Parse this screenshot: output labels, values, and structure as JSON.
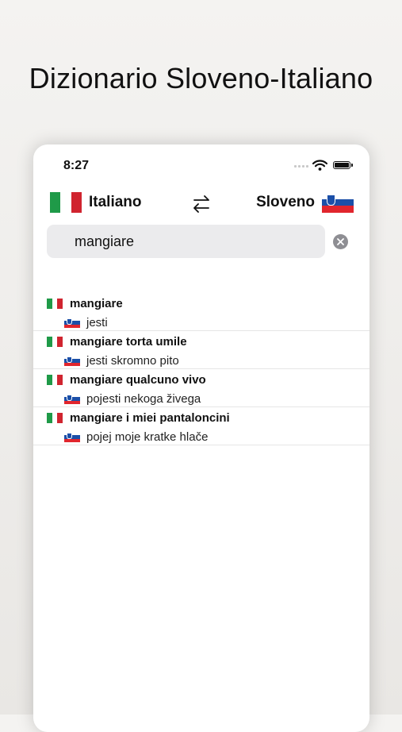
{
  "headline": "Dizionario Sloveno-Italiano",
  "status_bar": {
    "time": "8:27"
  },
  "colors": {
    "italy": [
      "#1f9a48",
      "#ffffff",
      "#d0242f"
    ],
    "slovenia": [
      "#ffffff",
      "#1b4fa8",
      "#e1252d"
    ]
  },
  "language_bar": {
    "source_label": "Italiano",
    "target_label": "Sloveno",
    "source_flag_icon": "italy-flag-icon",
    "target_flag_icon": "slovenia-flag-icon",
    "swap_icon": "swap-arrows-icon"
  },
  "search": {
    "value": "mangiare",
    "clear_icon": "clear-x-icon"
  },
  "results": [
    {
      "source": "mangiare",
      "translation": "jesti"
    },
    {
      "source": "mangiare torta umile",
      "translation": "jesti skromno pito"
    },
    {
      "source": "mangiare qualcuno vivo",
      "translation": "pojesti nekoga živega"
    },
    {
      "source": "mangiare i miei pantaloncini",
      "translation": "pojej moje kratke hlače"
    }
  ]
}
